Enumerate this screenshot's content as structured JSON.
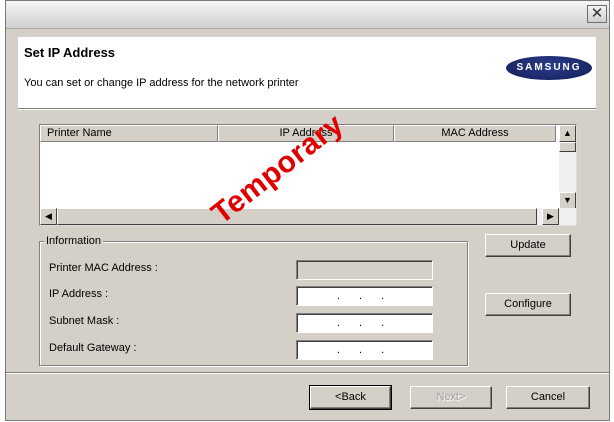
{
  "window": {
    "close_glyph": "✕",
    "close_icon": "close-icon"
  },
  "header": {
    "title": "Set IP Address",
    "subtitle": "You can set or change IP address for the network printer",
    "brand": "SAMSUNG"
  },
  "printer_list": {
    "columns": [
      "Printer Name",
      "IP Address",
      "MAC Address"
    ],
    "rows": [],
    "scroll_up_glyph": "▲",
    "scroll_down_glyph": "▼",
    "scroll_left_glyph": "◀",
    "scroll_right_glyph": "▶"
  },
  "information": {
    "legend": "Information",
    "fields": [
      {
        "label": "Printer MAC Address :",
        "value": "",
        "enabled": false
      },
      {
        "label": "IP Address :",
        "value": ". . .",
        "enabled": true
      },
      {
        "label": "Subnet Mask :",
        "value": ". . .",
        "enabled": true
      },
      {
        "label": "Default Gateway :",
        "value": ". . .",
        "enabled": true
      }
    ]
  },
  "buttons": {
    "update": "Update",
    "configure": "Configure",
    "back": "<Back",
    "next": "Next>",
    "cancel": "Cancel"
  },
  "watermark": "Temporary",
  "colors": {
    "watermark": "#e00000",
    "dialog_bg": "#d4d0c8",
    "brand_bg": "#1a2766"
  }
}
